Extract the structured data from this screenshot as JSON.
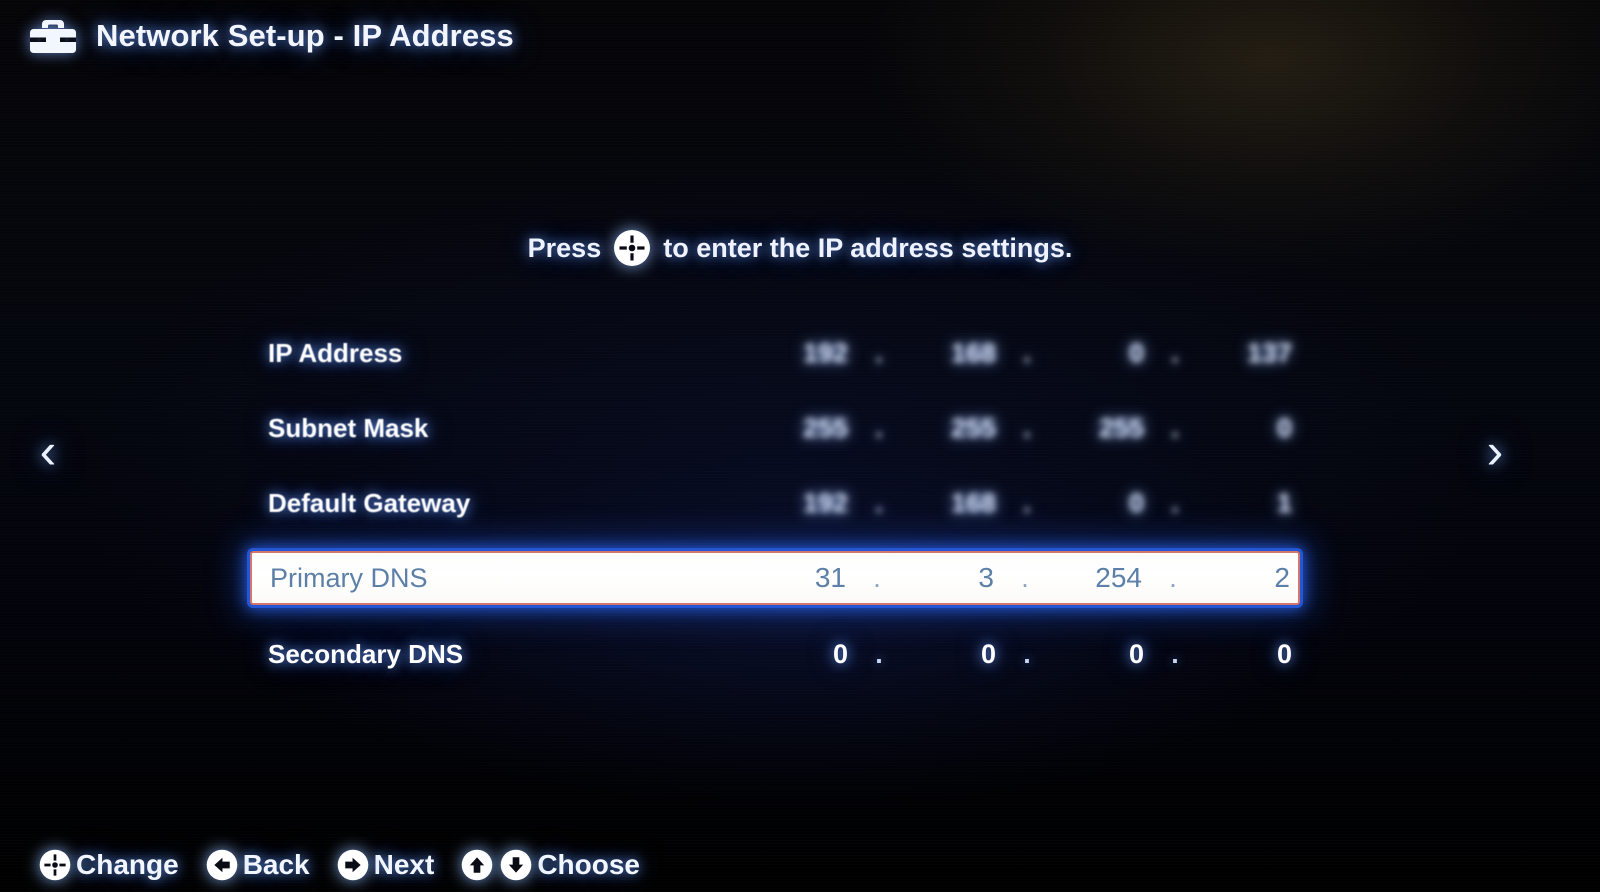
{
  "header": {
    "icon": "toolbox-icon",
    "title": "Network Set-up - IP Address"
  },
  "instruction": {
    "before": "Press",
    "icon": "dpad-icon",
    "after": "to enter the IP address settings."
  },
  "navigation": {
    "prev_icon": "chevron-left-icon",
    "prev_glyph": "‹",
    "next_icon": "chevron-right-icon",
    "next_glyph": "›"
  },
  "settings": {
    "separator": ".",
    "rows": [
      {
        "label": "IP Address",
        "octets": [
          "192",
          "168",
          "0",
          "137"
        ],
        "selected": false,
        "focus": "blurred"
      },
      {
        "label": "Subnet Mask",
        "octets": [
          "255",
          "255",
          "255",
          "0"
        ],
        "selected": false,
        "focus": "blurred"
      },
      {
        "label": "Default Gateway",
        "octets": [
          "192",
          "168",
          "0",
          "1"
        ],
        "selected": false,
        "focus": "blurred"
      },
      {
        "label": "Primary DNS",
        "octets": [
          "31",
          "3",
          "254",
          "2"
        ],
        "selected": true,
        "focus": "sharp"
      },
      {
        "label": "Secondary DNS",
        "octets": [
          "0",
          "0",
          "0",
          "0"
        ],
        "selected": false,
        "focus": "sharp"
      }
    ]
  },
  "footer": {
    "items": [
      {
        "icon": "dpad-icon",
        "label": "Change"
      },
      {
        "icon": "arrow-left-icon",
        "label": "Back"
      },
      {
        "icon": "arrow-right-icon",
        "label": "Next"
      },
      {
        "icon": "arrow-up-down-icon",
        "label": "Choose"
      }
    ]
  },
  "colors": {
    "background": "#000000",
    "text": "#ffffff",
    "glow": "#6a9bff",
    "selected_background": "#ffffff",
    "selected_border": "#d2756a",
    "selected_outline": "#2456d6",
    "selected_text": "#5c7fa8"
  }
}
